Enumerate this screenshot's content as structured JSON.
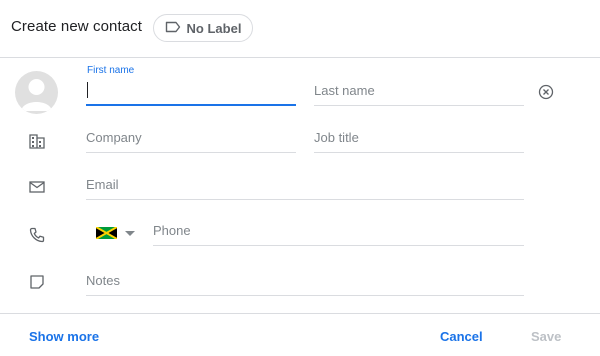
{
  "header": {
    "title": "Create new contact",
    "label_chip": "No Label"
  },
  "form": {
    "first_name": {
      "label": "First name",
      "value": "",
      "placeholder": ""
    },
    "last_name": {
      "placeholder": "Last name",
      "value": ""
    },
    "company": {
      "placeholder": "Company",
      "value": ""
    },
    "job_title": {
      "placeholder": "Job title",
      "value": ""
    },
    "email": {
      "placeholder": "Email",
      "value": ""
    },
    "phone": {
      "placeholder": "Phone",
      "value": ""
    },
    "notes": {
      "placeholder": "Notes",
      "value": ""
    }
  },
  "icons": {
    "label": "label-outline-icon",
    "avatar": "person-avatar-icon",
    "clear": "clear-circle-icon",
    "company": "building-icon",
    "email": "mail-icon",
    "phone": "phone-icon",
    "notes": "note-icon",
    "country": "jamaica-flag-icon",
    "country_dropdown": "caret-down-icon"
  },
  "footer": {
    "show_more": "Show more",
    "cancel": "Cancel",
    "save": "Save"
  },
  "colors": {
    "accent": "#1a73e8",
    "divider": "#dadce0",
    "icon": "#5f6368",
    "disabled": "#bdc1c6",
    "avatar_bg": "#e0e0e0"
  }
}
